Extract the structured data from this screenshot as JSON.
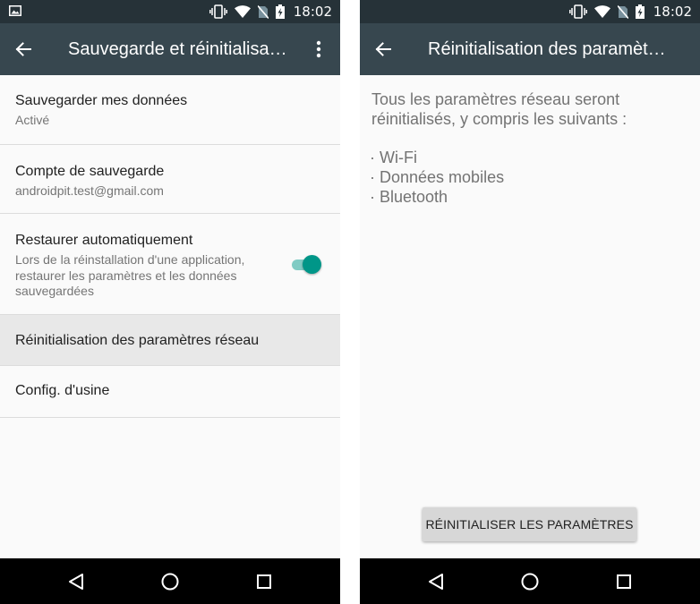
{
  "status_bar": {
    "time": "18:02"
  },
  "left_screen": {
    "title": "Sauvegarde et réinitialisa…",
    "items": [
      {
        "title": "Sauvegarder mes données",
        "subtitle": "Activé"
      },
      {
        "title": "Compte de sauvegarde",
        "subtitle": "androidpit.test@gmail.com"
      },
      {
        "title": "Restaurer automatiquement",
        "subtitle": "Lors de la réinstallation d'une application, restaurer les paramètres et les données sauvegardées",
        "toggle": "on"
      },
      {
        "title": "Réinitialisation des paramètres réseau"
      },
      {
        "title": "Config. d'usine"
      }
    ]
  },
  "right_screen": {
    "title": "Réinitialisation des paramèt…",
    "description": "Tous les paramètres réseau seront réinitialisés, y compris les suivants :",
    "list": [
      "· Wi-Fi",
      "· Données mobiles",
      "· Bluetooth"
    ],
    "button": "RÉINITIALISER LES PARAMÈTRES"
  },
  "colors": {
    "status_bar": "#263238",
    "toolbar": "#37474f",
    "accent": "#009688",
    "selected_item": "#e8e8e8",
    "nav_bar": "#000000"
  },
  "icons": [
    "image-icon",
    "vibrate-icon",
    "wifi-icon",
    "no-sim-icon",
    "battery-charging-icon",
    "back-arrow-icon",
    "more-vert-icon",
    "nav-back-icon",
    "nav-home-icon",
    "nav-recents-icon"
  ]
}
